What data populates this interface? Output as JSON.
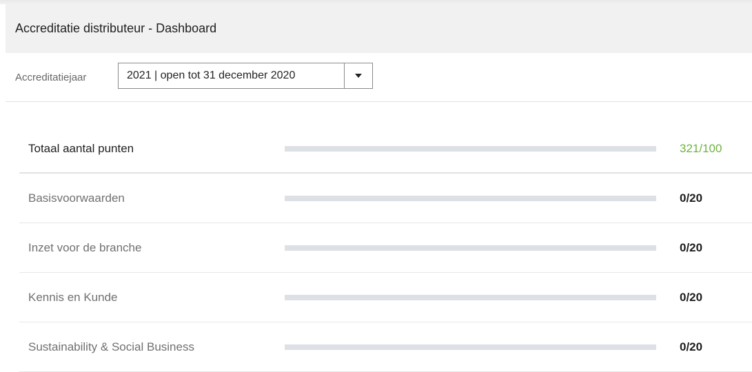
{
  "header": {
    "title": "Accreditatie distributeur - Dashboard"
  },
  "filter": {
    "label": "Accreditatiejaar",
    "selected": "2021 | open tot 31 december 2020"
  },
  "rows": [
    {
      "label": "Totaal aantal punten",
      "score": "321/100",
      "progress": 0
    },
    {
      "label": "Basisvoorwaarden",
      "score": "0/20",
      "progress": 0
    },
    {
      "label": "Inzet voor de branche",
      "score": "0/20",
      "progress": 0
    },
    {
      "label": "Kennis en Kunde",
      "score": "0/20",
      "progress": 0
    },
    {
      "label": "Sustainability & Social Business",
      "score": "0/20",
      "progress": 0
    }
  ],
  "colors": {
    "accent_green": "#6db33f",
    "track": "#dde1e5",
    "header_bg": "#f1f1f1"
  },
  "icons": {
    "dropdown": "caret-down-icon"
  }
}
